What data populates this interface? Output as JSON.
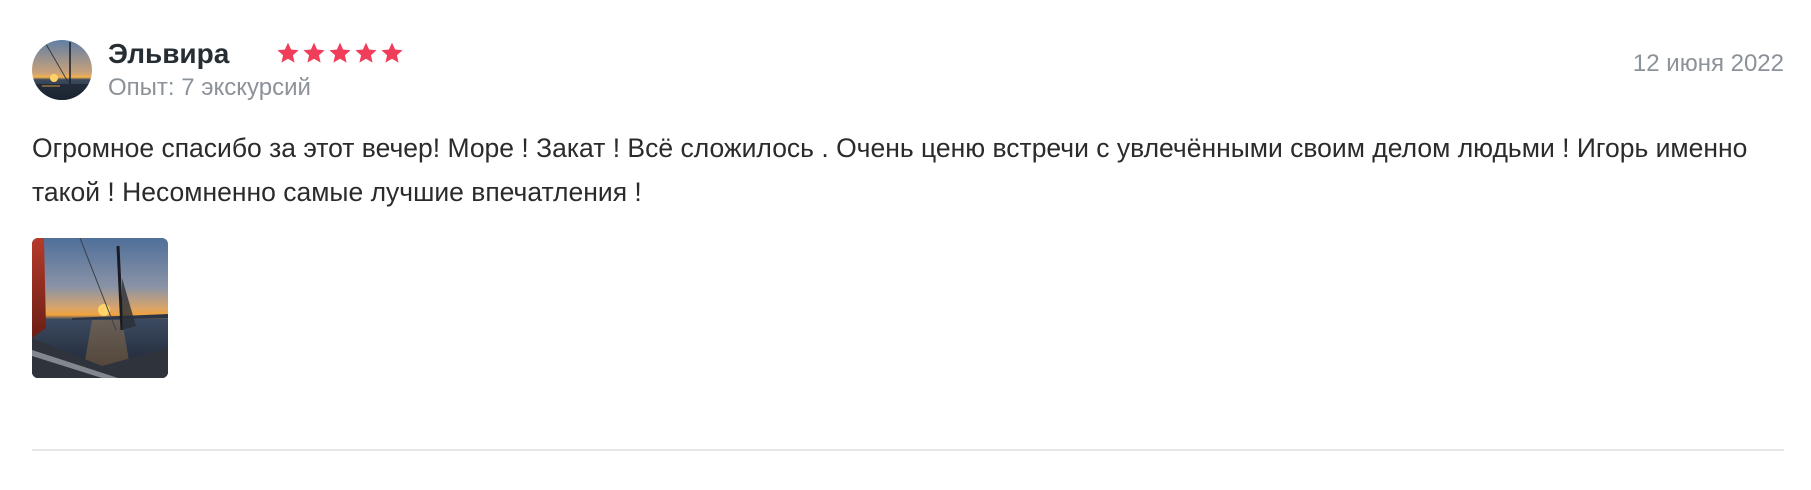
{
  "review": {
    "author": {
      "name": "Эльвира",
      "experience": "Опыт: 7 экскурсий",
      "avatar_icon": "sunset-sea-avatar"
    },
    "rating": {
      "value": 5,
      "max": 5,
      "star_color": "#f03d5a"
    },
    "date": "12 июня 2022",
    "text": "Огромное спасибо за этот вечер! Море ! Закат ! Всё сложилось . Очень ценю встречи с увлечёнными своим делом людьми ! Игорь именно такой ! Несомненно самые лучшие впечатления !",
    "photos": [
      {
        "icon": "sunset-sailboat-photo"
      }
    ]
  },
  "colors": {
    "name": "#262d33",
    "muted": "#8b9299",
    "text": "#2b2b2b",
    "divider": "#e4e6e8",
    "accent": "#f03d5a"
  }
}
